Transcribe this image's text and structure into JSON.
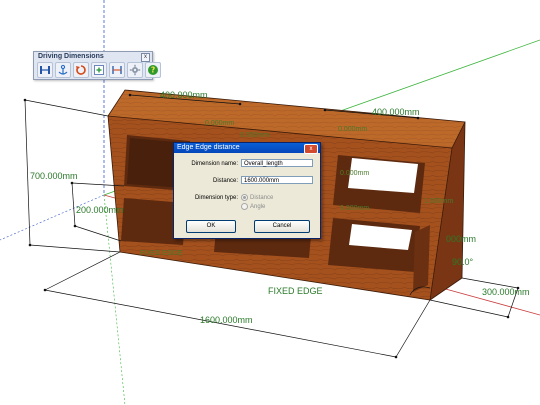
{
  "toolbar": {
    "title": "Driving Dimensions",
    "close_label": "x",
    "buttons": [
      {
        "icon": "linear-dimension-icon"
      },
      {
        "icon": "anchor-icon"
      },
      {
        "icon": "rotate-dimension-icon"
      },
      {
        "icon": "add-parameter-icon"
      },
      {
        "icon": "distance-icon"
      },
      {
        "icon": "settings-icon"
      },
      {
        "icon": "help-icon"
      }
    ]
  },
  "dialog": {
    "title": "Edge Edge distance",
    "close_label": "x",
    "name_label": "Dimension name:",
    "name_value": "Overall_length",
    "distance_label": "Distance:",
    "distance_value": "1600.000mm",
    "type_label": "Dimension type:",
    "type_options": [
      "Distance",
      "Angle"
    ],
    "ok_label": "OK",
    "cancel_label": "Cancel"
  },
  "model_labels": {
    "top_width_left": "400.000mm",
    "top_width_right": "400.000mm",
    "overall_height": "700.000mm",
    "shelf_height": "200.000mm",
    "depth": "300.000mm",
    "overall_length": "1600.000mm",
    "fixed_edge": "FIXED EDGE",
    "fixed_edge_small": "FIXED EDGE",
    "angle": "90.0°",
    "right_side": "000mm",
    "inner_a": "0.000mm",
    "inner_b": "0.000mm",
    "inner_c": "0.000mm",
    "inner_d": "0.000mm",
    "inner_e": "0.000mm",
    "inner_f": "1.000mm"
  },
  "colors": {
    "wood": "#a5511e",
    "wood_dark": "#7a3614",
    "dimension_text": "#2a7a2a",
    "axis_green": "#3cb43c",
    "axis_red": "#c83c3c",
    "dialog_title": "#0a5fd8"
  }
}
